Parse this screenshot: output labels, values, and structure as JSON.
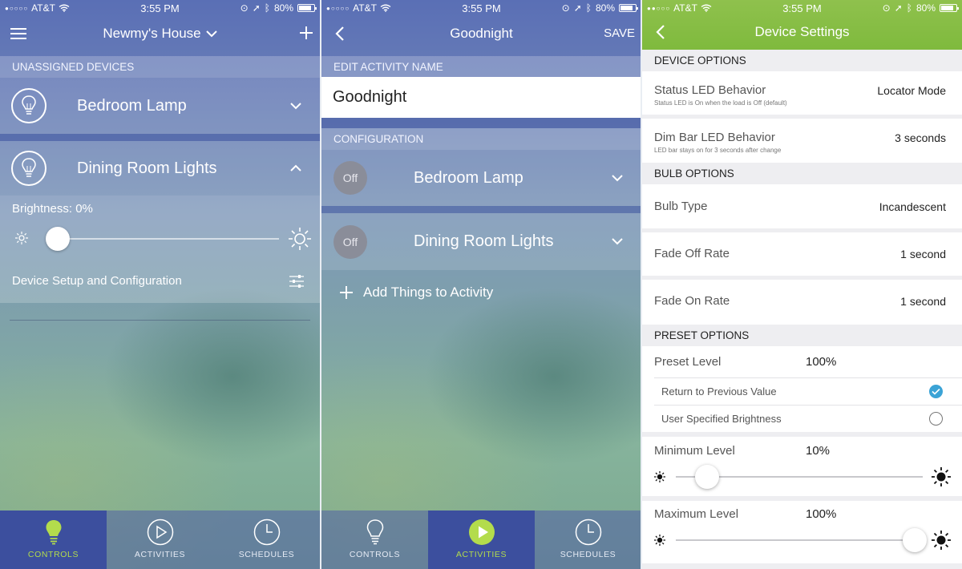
{
  "status": {
    "carrier": "AT&T",
    "time": "3:55 PM",
    "battery": "80%"
  },
  "panel1": {
    "title": "Newmy's House",
    "section_unassigned": "UNASSIGNED DEVICES",
    "devices": [
      {
        "name": "Bedroom Lamp"
      },
      {
        "name": "Dining Room Lights"
      }
    ],
    "brightness_label": "Brightness: 0%",
    "brightness_value": 0,
    "device_setup_label": "Device Setup and Configuration"
  },
  "panel2": {
    "title": "Goodnight",
    "save_label": "SAVE",
    "section_edit": "EDIT ACTIVITY NAME",
    "activity_name": "Goodnight",
    "section_config": "CONFIGURATION",
    "devices": [
      {
        "name": "Bedroom Lamp",
        "state": "Off"
      },
      {
        "name": "Dining Room Lights",
        "state": "Off"
      }
    ],
    "add_label": "Add Things to Activity"
  },
  "tabs": {
    "controls": "CONTROLS",
    "activities": "ACTIVITIES",
    "schedules": "SCHEDULES"
  },
  "panel3": {
    "title": "Device Settings",
    "section_device": "DEVICE OPTIONS",
    "status_led_label": "Status LED Behavior",
    "status_led_sub": "Status LED is On when the load is Off (default)",
    "status_led_value": "Locator Mode",
    "dim_bar_label": "Dim Bar LED Behavior",
    "dim_bar_sub": "LED bar stays on for 3 seconds after change",
    "dim_bar_value": "3 seconds",
    "section_bulb": "BULB OPTIONS",
    "bulb_type_label": "Bulb Type",
    "bulb_type_value": "Incandescent",
    "fade_off_label": "Fade Off Rate",
    "fade_off_value": "1 second",
    "fade_on_label": "Fade On Rate",
    "fade_on_value": "1 second",
    "section_preset": "PRESET OPTIONS",
    "preset_level_label": "Preset Level",
    "preset_level_value": "100%",
    "return_prev_label": "Return to Previous Value",
    "user_specified_label": "User Specified Brightness",
    "min_level_label": "Minimum Level",
    "min_level_value": "10%",
    "min_level_fraction": 0.1,
    "max_level_label": "Maximum Level",
    "max_level_value": "100%",
    "max_level_fraction": 1.0
  },
  "colors": {
    "accent_green": "#8fc14d",
    "active_tab_text": "#b3dc4c",
    "check_blue": "#3ba3d6"
  }
}
